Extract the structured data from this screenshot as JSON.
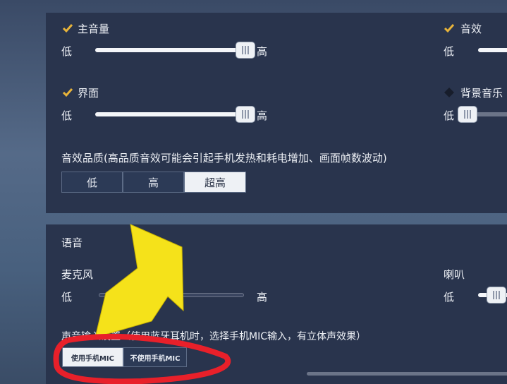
{
  "audio": {
    "master": {
      "label": "主音量",
      "checked": true,
      "low": "低",
      "high": "高",
      "value_percent": 100
    },
    "sfx": {
      "label": "音效",
      "checked": true,
      "low": "低"
    },
    "ui": {
      "label": "界面",
      "checked": true,
      "low": "低",
      "high": "高",
      "value_percent": 100
    },
    "bgm": {
      "label": "背景音乐",
      "checked": false,
      "low": "低",
      "value_percent": 0
    },
    "quality": {
      "label": "音效品质(高品质音效可能会引起手机发热和耗电增加、画面帧数波动)",
      "options": [
        "低",
        "高",
        "超高"
      ],
      "selected": "超高"
    }
  },
  "voice": {
    "title": "语音",
    "mic": {
      "label": "麦克风",
      "low": "低",
      "high": "高",
      "value_percent": 0
    },
    "speaker": {
      "label": "喇叭",
      "low": "低"
    },
    "input": {
      "label": "声音输入设置（使用蓝牙耳机时，选择手机MIC输入，有立体声效果）",
      "options": [
        "使用手机MIC",
        "不使用手机MIC"
      ],
      "selected": "使用手机MIC"
    }
  },
  "colors": {
    "accent": "#e8b43a",
    "panel": "#29344d",
    "arrow": "#f5e21a",
    "circle": "#e8202a"
  }
}
